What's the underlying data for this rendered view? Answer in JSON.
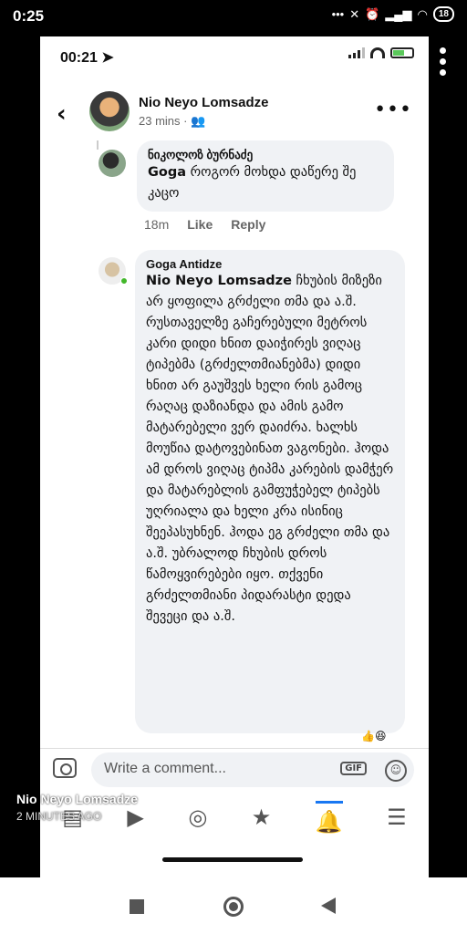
{
  "outer_status": {
    "time": "0:25",
    "battery": "18"
  },
  "inner_status": {
    "time": "00:21"
  },
  "post": {
    "name": "Nio Neyo Lomsadze",
    "meta": "23 mins · ",
    "audience_icon": "friends-icon"
  },
  "comment1": {
    "author": "ნიკოლოზ ბურნაძე",
    "mention": "Goga",
    "text": "როგორ მოხდა დაწერე შე კაცო",
    "time": "18m",
    "like": "Like",
    "reply": "Reply"
  },
  "comment2": {
    "author": "Goga Antidze",
    "mention": "Nio Neyo Lomsadze",
    "text": "ჩხუბის მიზეზი არ ყოფილა გრძელი თმა და ა.შ. რუსთაველზე გაჩერებული მეტროს კარი დიდი ხნით დაიჭირეს ვიღაც ტიპებმა (გრძელთმიანებმა) დიდი ხნით არ გაუშვეს ხელი რის გამოც რაღაც დაზიანდა და ამის გამო მატარებელი ვერ დაიძრა. ხალხს მოუწია დატოვებინათ ვაგონები. ჰოდა ამ დროს ვიღაც ტიპმა კარების დამჭერ და მატარებლის გამფუჭებელ ტიპებს უღრიალა და ხელი კრა ისინიც შეეპასუხნენ. ჰოდა ეგ გრძელი თმა და ა.შ. უბრალოდ ჩხუბის დროს წამოყვირებები იყო. თქვენი გრძელთმიანი პიდარასტი დედა შევეცი და ა.შ."
  },
  "comment_bar": {
    "placeholder": "Write a comment...",
    "gif": "GIF"
  },
  "overlay": {
    "name": "Nio Neyo Lomsadze",
    "time": "2 MINUTES AGO"
  },
  "colors": {
    "accent": "#1877f2",
    "bubble": "#f0f2f5"
  }
}
